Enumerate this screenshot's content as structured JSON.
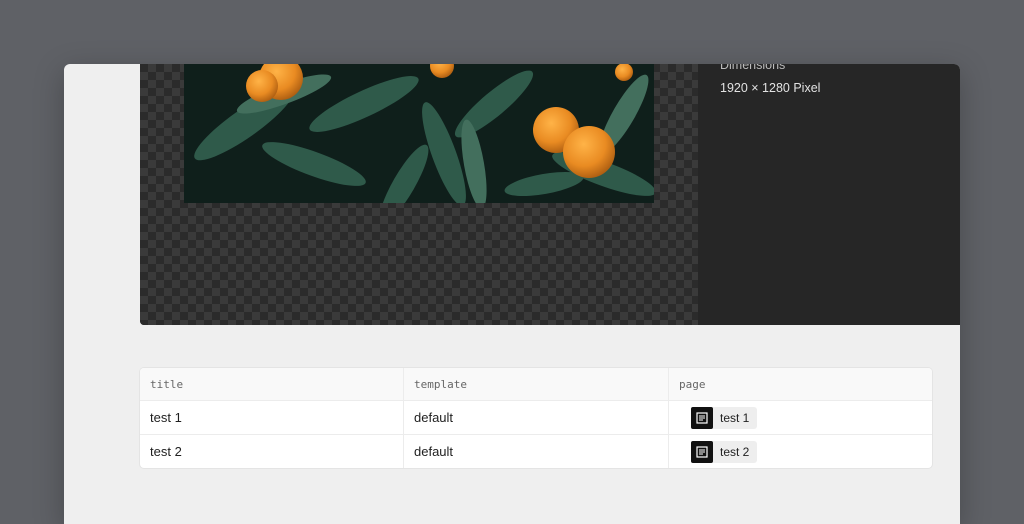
{
  "preview": {
    "dimensions_label": "Dimensions",
    "dimensions_value": "1920 × 1280 Pixel"
  },
  "table": {
    "columns": [
      "title",
      "template",
      "page"
    ],
    "rows": [
      {
        "title": "test 1",
        "template": "default",
        "page": "test 1",
        "page_icon": "page-icon"
      },
      {
        "title": "test 2",
        "template": "default",
        "page": "test 2",
        "page_icon": "page-icon"
      }
    ]
  }
}
